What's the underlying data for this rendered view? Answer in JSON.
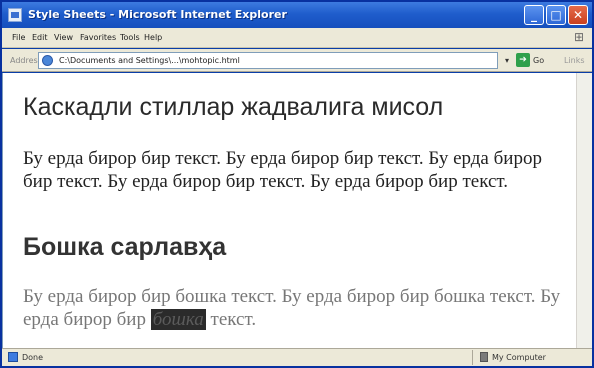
{
  "window": {
    "title": "Style Sheets - Microsoft Internet Explorer",
    "minimize_glyph": "_",
    "maximize_glyph": "□",
    "close_glyph": "✕"
  },
  "menu": {
    "items": [
      "File",
      "Edit",
      "View",
      "Favorites",
      "Tools",
      "Help"
    ]
  },
  "address_bar": {
    "label": "Address",
    "url": "C:\\Documents and Settings\\...\\mohtopic.html",
    "dropdown_glyph": "▾",
    "go_glyph": "➔",
    "go_label": "Go",
    "links_label": "Links"
  },
  "page": {
    "heading1": "Каскадли стиллар жадвалига мисол",
    "paragraph1": "Бу ерда бирор бир текст. Бу ерда бирор бир текст. Бу ерда бирор бир текст. Бу ерда бирор бир текст. Бу ерда бирор бир текст.",
    "heading2": "Бошка сарлавҳа",
    "paragraph2_before": "Бу ерда бирор бир бошка текст. Бу ерда бирор бир бошка текст. Бу ерда бирор бир ",
    "paragraph2_highlight": "бошка",
    "paragraph2_after": " текст."
  },
  "status_bar": {
    "status": "Done",
    "zone": "My Computer"
  },
  "colors": {
    "titlebar": "#1f5dcc",
    "chrome": "#ece9d8",
    "highlight_bg": "#2b2b2b"
  },
  "icons": [
    "ie-page-icon",
    "minimize-icon",
    "maximize-icon",
    "close-icon",
    "windows-logo-icon",
    "page-icon",
    "go-arrow-icon",
    "ie-status-icon",
    "computer-icon"
  ]
}
